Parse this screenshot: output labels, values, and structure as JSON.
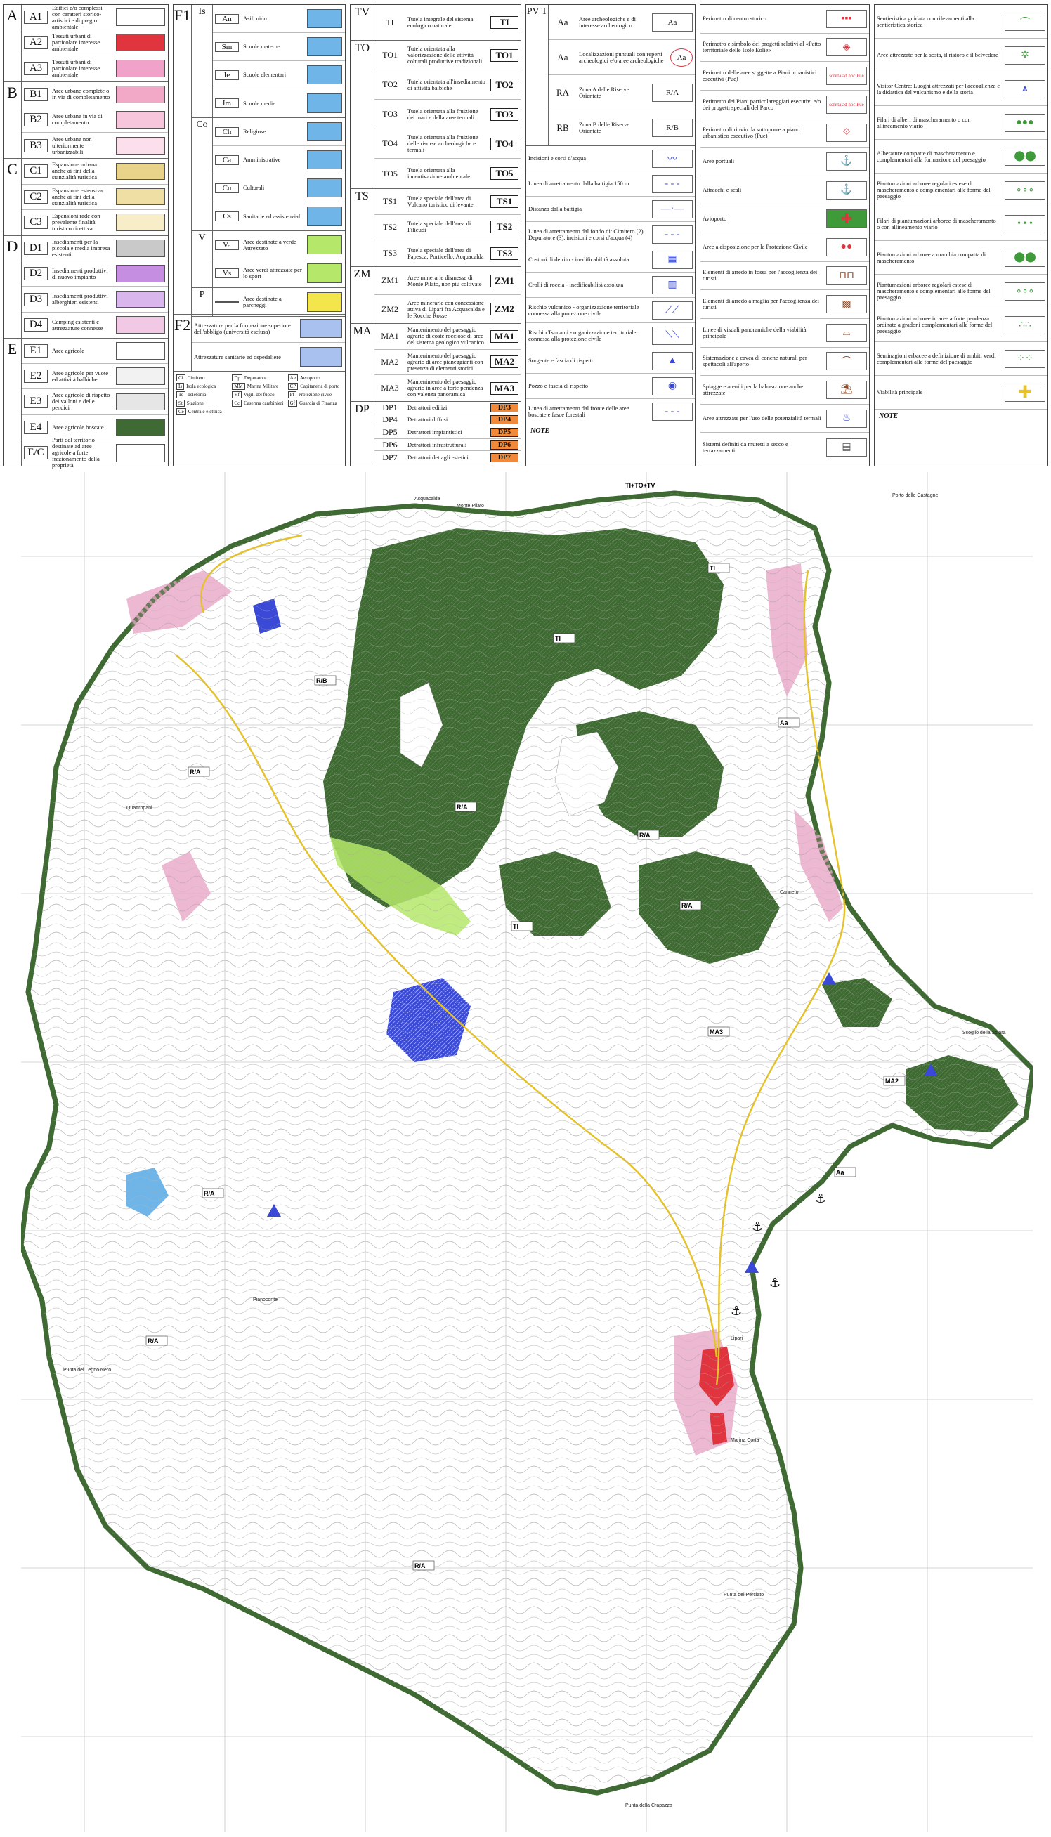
{
  "colors": {
    "green_dark": "#3f6a33",
    "pink": "#e9a6c7",
    "red": "#e0343f",
    "blue": "#4a55d9",
    "light_blue": "#6fb5e8",
    "yellow": "#f2e64c",
    "lime": "#b5e86a",
    "water": "#ffffff"
  },
  "panel1": {
    "groups": [
      {
        "letter": "A",
        "rows": [
          {
            "code": "A1",
            "desc": "Edifici e/o complessi con caratteri storico-artistici e di pregio ambientale",
            "swatch": "#ffffff"
          },
          {
            "code": "A2",
            "desc": "Tessuti urbani di particolare interesse ambientale",
            "swatch": "#e0343f"
          },
          {
            "code": "A3",
            "desc": "Tessuti urbani di particolare interesse ambientale",
            "swatch": "#f0a2c8"
          }
        ]
      },
      {
        "letter": "B",
        "rows": [
          {
            "code": "B1",
            "desc": "Aree urbane complete o in via di completamento",
            "swatch": "#f2a9c8"
          },
          {
            "code": "B2",
            "desc": "Aree urbane in via di completamento",
            "swatch": "#f7c6dc"
          },
          {
            "code": "B3",
            "desc": "Aree urbane non ulteriormente urbanizzabili",
            "swatch": "#fbe0ec"
          }
        ]
      },
      {
        "letter": "C",
        "rows": [
          {
            "code": "C1",
            "desc": "Espansione urbana anche ai fini della stanzialità turistica",
            "swatch": "#e9d28a"
          },
          {
            "code": "C2",
            "desc": "Espansione estensiva anche ai fini della stanzialità turistica",
            "swatch": "#f0dfa5"
          },
          {
            "code": "C3",
            "desc": "Espansioni rade con prevalente finalità turistico ricettiva",
            "swatch": "#f7edc9"
          }
        ]
      },
      {
        "letter": "D",
        "rows": [
          {
            "code": "D1",
            "desc": "Insediamenti per la piccola e media impresa esistenti",
            "swatch": "#c9c9c9"
          },
          {
            "code": "D2",
            "desc": "Insediamenti produttivi di nuovo impianto",
            "swatch": "#c68ee0"
          },
          {
            "code": "D3",
            "desc": "Insediamenti produttivi alberghieri esistenti",
            "swatch": "#d9b7ec"
          },
          {
            "code": "D4",
            "desc": "Camping esistenti e attrezzature connesse",
            "swatch": "#f1c9e4"
          }
        ]
      },
      {
        "letter": "E",
        "rows": [
          {
            "code": "E1",
            "desc": "Aree agricole",
            "swatch": "#ffffff"
          },
          {
            "code": "E2",
            "desc": "Aree agricole per vuote ed attività balbiche",
            "swatch": "#f2f2f2"
          },
          {
            "code": "E3",
            "desc": "Aree agricole di rispetto dei valloni e delle pendici",
            "swatch": "#e6e6e6"
          },
          {
            "code": "E4",
            "desc": "Aree agricole boscate",
            "swatch": "#3f6a33"
          },
          {
            "code": "E/C",
            "desc": "Parti del territorio destinate ad aree agricole a forte frazionamento della proprietà",
            "swatch": "#ffffff"
          }
        ]
      }
    ]
  },
  "panel2": {
    "f1": {
      "letter": "F1",
      "groups": [
        {
          "sub": "Is",
          "rows": [
            {
              "code": "An",
              "desc": "Asili nido",
              "swatch": "#6fb5e8"
            },
            {
              "code": "Sm",
              "desc": "Scuole materne",
              "swatch": "#6fb5e8"
            },
            {
              "code": "Ie",
              "desc": "Scuole elementari",
              "swatch": "#6fb5e8"
            },
            {
              "code": "Im",
              "desc": "Scuole medie",
              "swatch": "#6fb5e8"
            }
          ]
        },
        {
          "sub": "Co",
          "rows": [
            {
              "code": "Ch",
              "desc": "Religiose",
              "swatch": "#6fb5e8"
            },
            {
              "code": "Ca",
              "desc": "Amministrative",
              "swatch": "#6fb5e8"
            },
            {
              "code": "Cu",
              "desc": "Culturali",
              "swatch": "#6fb5e8"
            },
            {
              "code": "Cs",
              "desc": "Sanitarie ed assistenziali",
              "swatch": "#6fb5e8"
            }
          ]
        },
        {
          "sub": "V",
          "rows": [
            {
              "code": "Va",
              "desc": "Aree destinate a verde Attrezzato",
              "swatch": "#b5e86a"
            },
            {
              "code": "Vs",
              "desc": "Aree verdi attrezzate per lo sport",
              "swatch": "#b5e86a"
            }
          ]
        },
        {
          "sub": "P",
          "rows": [
            {
              "code": "",
              "desc": "Aree destinate a parcheggi",
              "swatch": "#f2e64c"
            }
          ]
        }
      ]
    },
    "f2": {
      "letter": "F2",
      "rows": [
        {
          "desc": "Attrezzature per la formazione superiore dell'obbligo (università esclusa)",
          "swatch": "#a9c1ef"
        },
        {
          "desc": "Attrezzature sanitarie ed ospedaliere",
          "swatch": "#a9c1ef"
        }
      ]
    },
    "impianti": [
      {
        "code": "Ci",
        "label": "Cimitero"
      },
      {
        "code": "Dp",
        "label": "Depuratore"
      },
      {
        "code": "Ae",
        "label": "Aeroporto"
      },
      {
        "code": "Is",
        "label": "Isola ecologica"
      },
      {
        "code": "MM",
        "label": "Marina Militare"
      },
      {
        "code": "CP",
        "label": "Capitaneria di porto"
      },
      {
        "code": "Te",
        "label": "Telefonia"
      },
      {
        "code": "Vf",
        "label": "Vigili del fuoco"
      },
      {
        "code": "Pf",
        "label": "Protezione civile"
      },
      {
        "code": "St",
        "label": "Stazione"
      },
      {
        "code": "Cc",
        "label": "Caserma carabinieri"
      },
      {
        "code": "Gf",
        "label": "Guardia di Finanza"
      },
      {
        "code": "Ce",
        "label": "Centrale elettrica"
      }
    ]
  },
  "panel3": {
    "tv": {
      "letter": "TV",
      "rows": [
        {
          "code": "TI",
          "desc": "Tutela integrale del sistema ecologico naturale",
          "box": "TI"
        }
      ]
    },
    "to": {
      "letter": "TO",
      "rows": [
        {
          "code": "TO1",
          "desc": "Tutela orientata alla valorizzazione delle attività colturali produttive tradizionali",
          "box": "TO1"
        },
        {
          "code": "TO2",
          "desc": "Tutela orientata all'insediamento di attività balbiche",
          "box": "TO2"
        },
        {
          "code": "TO3",
          "desc": "Tutela orientata alla fruizione dei mari e della aree termali",
          "box": "TO3"
        },
        {
          "code": "TO4",
          "desc": "Tutela orientata alla fruizione delle risorse archeologiche e termali",
          "box": "TO4"
        },
        {
          "code": "TO5",
          "desc": "Tutela orientata alla incentivazione ambientale",
          "box": "TO5"
        }
      ]
    },
    "ts": {
      "letter": "TS",
      "rows": [
        {
          "code": "TS1",
          "desc": "Tutela speciale dell'area di Vulcano turistico di levante",
          "box": "TS1"
        },
        {
          "code": "TS2",
          "desc": "Tutela speciale dell'area di Filicudi",
          "box": "TS2"
        },
        {
          "code": "TS3",
          "desc": "Tutela speciale dell'area di Papesca, Porticello, Acquacalda",
          "box": "TS3"
        }
      ]
    },
    "zm": {
      "letter": "ZM",
      "rows": [
        {
          "code": "ZM1",
          "desc": "Aree minerarie dismesse di Monte Pilato, non più coltivate",
          "box": "ZM1"
        },
        {
          "code": "ZM2",
          "desc": "Aree minerarie con concessione attiva di Lipari fra Acquacalda e le Rocche Rosse",
          "box": "ZM2"
        }
      ]
    },
    "ma": {
      "letter": "MA",
      "rows": [
        {
          "code": "MA1",
          "desc": "Mantenimento del paesaggio agrario di coste rocciose di aree del sistema geologico vulcanico",
          "box": "MA1"
        },
        {
          "code": "MA2",
          "desc": "Mantenimento del paesaggio agrario di aree pianeggianti con presenza di elementi storici",
          "box": "MA2"
        },
        {
          "code": "MA3",
          "desc": "Mantenimento del paesaggio agrario in aree a forte pendenza con valenza panoramica",
          "box": "MA3"
        }
      ]
    },
    "dp": {
      "letter": "DP",
      "rows": [
        {
          "code": "DP1",
          "desc": "Detrattori edilizi",
          "box": "DP3"
        },
        {
          "code": "DP4",
          "desc": "Detrattori diffusi",
          "box": "DP4"
        },
        {
          "code": "DP5",
          "desc": "Detrattori impiantistici",
          "box": "DP5"
        },
        {
          "code": "DP6",
          "desc": "Detrattori infrastrutturali",
          "box": "DP6"
        },
        {
          "code": "DP7",
          "desc": "Detrattori dettagli estetici",
          "box": "DP7"
        }
      ]
    }
  },
  "panel4": {
    "pvt": {
      "letter": "PV T",
      "rows": [
        {
          "code": "Aa",
          "desc": "Aree archeologiche e di interesse archeologico",
          "sym": "Aa"
        },
        {
          "code": "Aa",
          "desc": "Localizzazioni puntuali con reperti archeologici e/o aree archeologiche",
          "sym": "Aa"
        },
        {
          "code": "RA",
          "desc": "Zona A delle Riserve Orientate",
          "sym": "R/A"
        },
        {
          "code": "RB",
          "desc": "Zona B delle Riserve Orientate",
          "sym": "R/B"
        }
      ]
    },
    "rows": [
      {
        "desc": "Incisioni e corsi d'acqua"
      },
      {
        "desc": "Linea di arretramento dalla battigia 150 m"
      },
      {
        "desc": "Distanza dalla battigia"
      },
      {
        "desc": "Linea di arretramento dal fondo di: Cimitero (2), Depuratore (3), incisioni e corsi d'acqua (4)"
      },
      {
        "desc": "Costoni di detrito - inedificabilità assoluta"
      },
      {
        "desc": "Crolli di roccia - inedificabilità assoluta"
      },
      {
        "desc": "Rischio vulcanico - organizzazione territoriale connessa alla protezione civile"
      },
      {
        "desc": "Rischio Tsunami - organizzazione territoriale connessa alla protezione civile"
      },
      {
        "desc": "Sorgente e fascia di rispetto"
      },
      {
        "desc": "Pozzo e fascia di rispetto"
      },
      {
        "desc": "Linea di arretramento dal fronte delle aree boscate e fasce forestali"
      }
    ],
    "note": "NOTE"
  },
  "panel5": {
    "rows": [
      {
        "desc": "Perimetro di centro storico"
      },
      {
        "desc": "Perimetro e simbolo dei progetti relativi al «Patto territoriale delle Isole Eolie»"
      },
      {
        "desc": "Perimetro delle aree soggette a Piani urbanistici esecutivi (Pue)",
        "tag": "scritta ad hoc Pue"
      },
      {
        "desc": "Perimetro dei Piani particolareggiati esecutivi e/o dei progetti speciali del Parco",
        "tag": "scritta ad hoc Pue"
      },
      {
        "desc": "Perimetro di rinvio da sottoporre a piano urbanistico esecutivo (Pue)"
      },
      {
        "desc": "Aree portuali"
      },
      {
        "desc": "Attracchi e scali"
      },
      {
        "desc": "Avioporto"
      },
      {
        "desc": "Aree a disposizione per la Protezione Civile"
      },
      {
        "desc": "Elementi di arredo in fossa per l'accoglienza dei turisti"
      },
      {
        "desc": "Elementi di arredo a maglia per l'accoglienza dei turisti"
      },
      {
        "desc": "Linee di visuali panoramiche della viabilità principale"
      },
      {
        "desc": "Sistemazione a cavea di conche naturali per spettacoli all'aperto"
      },
      {
        "desc": "Spiagge e arenili per la balneazione anche attrezzate"
      },
      {
        "desc": "Aree attrezzate per l'uso delle potenzialità termali"
      },
      {
        "desc": "Sistemi definiti da muretti a secco e terrazzamenti"
      }
    ]
  },
  "panel6": {
    "rows": [
      {
        "desc": "Sentieristica guidata con rilevamenti alla sentieristica storica"
      },
      {
        "desc": "Aree attrezzate per la sosta, il ristoro e il belvedere"
      },
      {
        "desc": "Visitor Centre: Luoghi attrezzati per l'accoglienza e la didattica del vulcanismo e della storia"
      },
      {
        "desc": "Filari di alberi di mascheramento o con allineamento viario"
      },
      {
        "desc": "Alberature compatte di mascheramento e complementari alla formazione del paesaggio"
      },
      {
        "desc": "Piantumazioni arboree regolari estese di mascheramento e complementari alle forme del paesaggio"
      },
      {
        "desc": "Filari di piantumazioni arboree di mascheramento o con allineamento viario"
      },
      {
        "desc": "Piantumazioni arboree a macchia compatta di mascheramento"
      },
      {
        "desc": "Piantumazioni arboree regolari estese di mascheramento e complementari alle forme del paesaggio"
      },
      {
        "desc": "Piantumazioni arboree in aree a forte pendenza ordinate a gradoni complementari alle forme del paesaggio"
      },
      {
        "desc": "Seminagioni erbacee a definizione di ambiti verdi complementari alle forme del paesaggio"
      },
      {
        "desc": "Viabilità principale"
      }
    ],
    "note": "NOTE"
  },
  "map": {
    "title_tag": "TI+TO+TV",
    "place_labels": [
      {
        "text": "Acquacalda"
      },
      {
        "text": "Porto delle Castagne"
      },
      {
        "text": "Canneto"
      },
      {
        "text": "Lipari"
      },
      {
        "text": "Marina Corta"
      },
      {
        "text": "Punta della Crapazza"
      },
      {
        "text": "Monte Pilato"
      },
      {
        "text": "Quattropani"
      },
      {
        "text": "Pianoconte"
      },
      {
        "text": "Punta del Perciato"
      },
      {
        "text": "Scoglio della Sciara"
      },
      {
        "text": "Punta del Legno Nero"
      }
    ],
    "zone_tags": [
      "R/A",
      "R/A",
      "R/A",
      "R/A",
      "R/B",
      "R/A",
      "R/A",
      "R/A",
      "TI",
      "TI",
      "TI",
      "MA2",
      "MA3",
      "Aa",
      "Aa"
    ]
  }
}
